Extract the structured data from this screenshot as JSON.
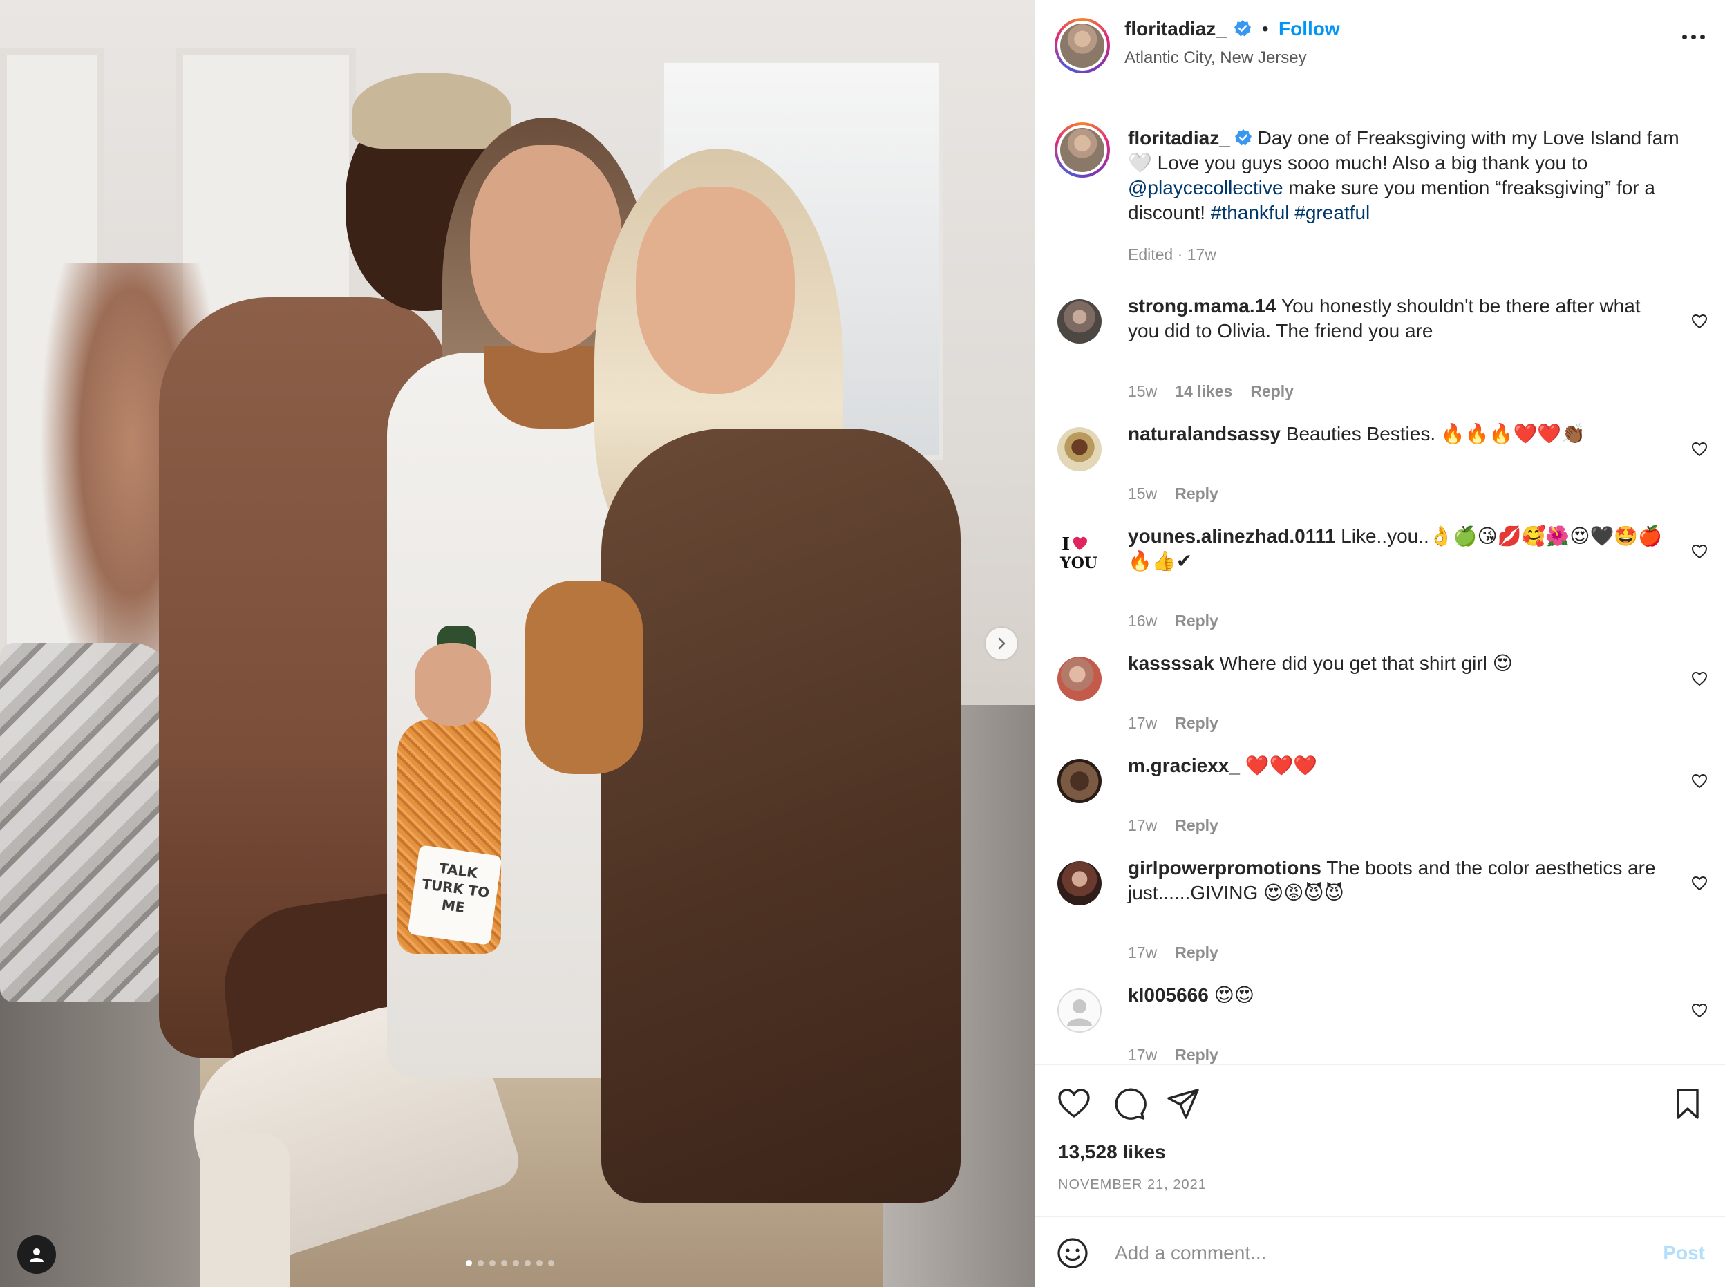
{
  "post": {
    "author": "floritadiaz_",
    "verified": true,
    "follow_label": "Follow",
    "separator": "•",
    "location": "Atlantic City, New Jersey",
    "more_icon": "more-horizontal-icon",
    "photo": {
      "bottle_label": "TALK TURK TO ME",
      "carousel_total": 8,
      "carousel_index": 1,
      "next_icon": "chevron-right-icon",
      "tag_icon": "user-tag-icon"
    }
  },
  "caption": {
    "username": "floritadiaz_",
    "text_part1": " Day one of Freaksgiving with my Love Island fam 🤍 Love you guys sooo much! Also a big thank you to ",
    "mention": "@playcecollective",
    "text_part2": " make sure you mention “freaksgiving” for a discount! ",
    "hashtag1": "#thankful",
    "hashtag2": "#greatful",
    "meta": "Edited · 17w"
  },
  "comments": [
    {
      "username": "strong.mama.14",
      "text": " You honestly shouldn't be there after what you did to Olivia. The friend you are",
      "time": "15w",
      "likes": "14 likes",
      "reply": "Reply"
    },
    {
      "username": "naturalandsassy",
      "text": " Beauties Besties. 🔥🔥🔥❤️❤️👏🏾",
      "time": "15w",
      "likes": "",
      "reply": "Reply"
    },
    {
      "username": "younes.alinezhad.0111",
      "text": " Like..you..👌🍏😘💋🥰🌺😍🖤🤩🍎🔥👍✔",
      "time": "16w",
      "likes": "",
      "reply": "Reply"
    },
    {
      "username": "kassssak",
      "text": " Where did you get that shirt girl 😍",
      "time": "17w",
      "likes": "",
      "reply": "Reply"
    },
    {
      "username": "m.graciexx_",
      "text": " ❤️❤️❤️",
      "time": "17w",
      "likes": "",
      "reply": "Reply"
    },
    {
      "username": "girlpowerpromotions",
      "text": " The boots and the color aesthetics are just......GIVING 😍😡😈😈",
      "time": "17w",
      "likes": "",
      "reply": "Reply"
    },
    {
      "username": "kl005666",
      "text": " 😍😍",
      "time": "17w",
      "likes": "",
      "reply": "Reply"
    }
  ],
  "footer": {
    "likes": "13,528 likes",
    "date": "NOVEMBER 21, 2021",
    "icons": [
      "heart-icon",
      "comment-icon",
      "share-icon",
      "bookmark-icon"
    ],
    "add_comment_placeholder": "Add a comment...",
    "post_label": "Post"
  },
  "colors": {
    "link": "#00376b",
    "follow": "#0095f6",
    "muted": "#8e8e8e",
    "post_disabled": "#b2dffc"
  }
}
